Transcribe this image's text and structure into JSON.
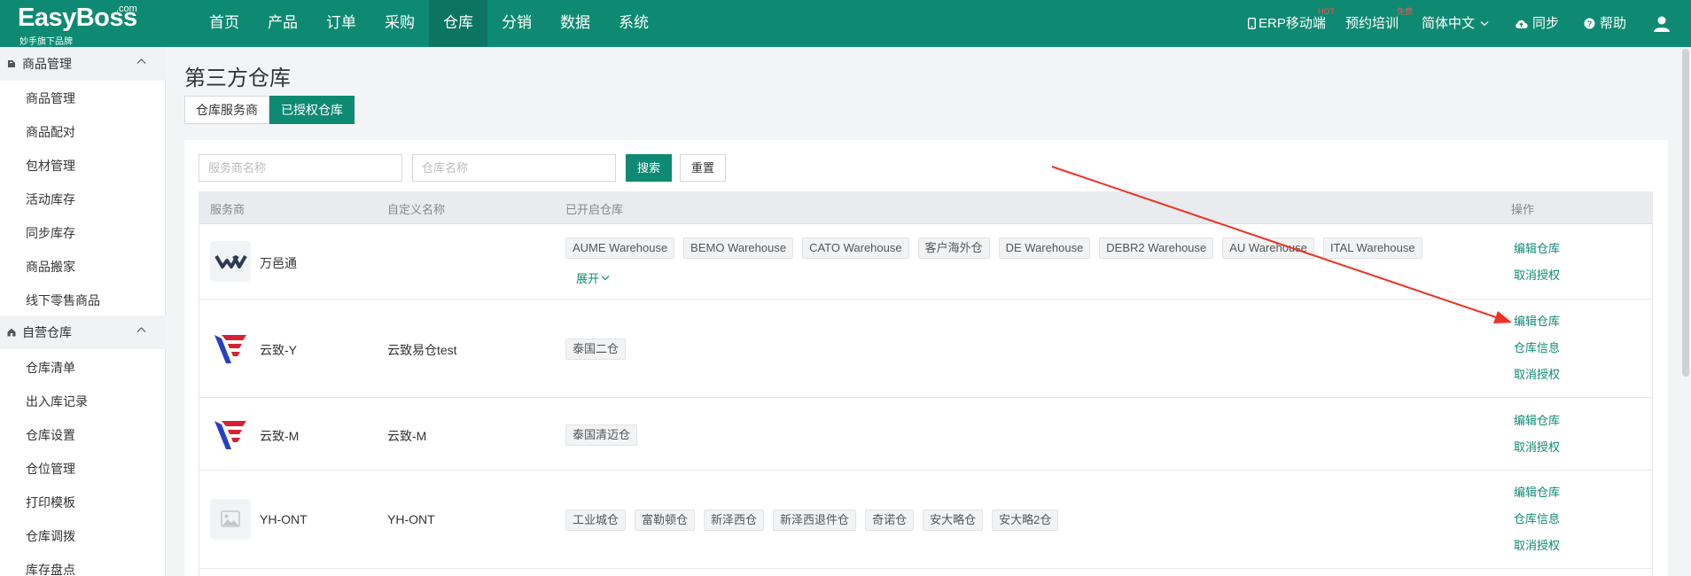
{
  "brand": {
    "name": "EasyBoss",
    "domain": ".com",
    "slogan": "妙手旗下品牌"
  },
  "nav": [
    {
      "label": "首页"
    },
    {
      "label": "产品"
    },
    {
      "label": "订单"
    },
    {
      "label": "采购"
    },
    {
      "label": "仓库",
      "active": true
    },
    {
      "label": "分销"
    },
    {
      "label": "数据"
    },
    {
      "label": "系统"
    }
  ],
  "topright": {
    "erp": "ERP移动端",
    "erp_badge": "HOT",
    "training": "预约培训",
    "training_badge": "免费",
    "lang": "简体中文",
    "sync": "同步",
    "help": "帮助"
  },
  "sidebar": {
    "group1": {
      "label": "商品管理",
      "items": [
        "商品管理",
        "商品配对",
        "包材管理",
        "活动库存",
        "同步库存",
        "商品搬家",
        "线下零售商品"
      ]
    },
    "group2": {
      "label": "自营仓库",
      "items": [
        "仓库清单",
        "出入库记录",
        "仓库设置",
        "仓位管理",
        "打印模板",
        "仓库调拨",
        "库存盘点"
      ]
    }
  },
  "page": {
    "title": "第三方仓库",
    "tabs": [
      {
        "label": "仓库服务商"
      },
      {
        "label": "已授权仓库",
        "active": true
      }
    ]
  },
  "filters": {
    "provider_placeholder": "服务商名称",
    "warehouse_placeholder": "仓库名称",
    "search": "搜索",
    "reset": "重置"
  },
  "table": {
    "headers": {
      "provider": "服务商",
      "custom_name": "自定义名称",
      "warehouses": "已开启仓库",
      "actions": "操作"
    },
    "rows": [
      {
        "provider": "万邑通",
        "custom_name": "",
        "logo": "winit-logo",
        "warehouses": [
          "AUME Warehouse",
          "BEMO Warehouse",
          "CATO Warehouse",
          "客户海外仓",
          "DE Warehouse",
          "DEBR2 Warehouse",
          "AU Warehouse",
          "ITAL Warehouse"
        ],
        "expand": "展开",
        "actions": [
          "编辑仓库",
          "取消授权"
        ]
      },
      {
        "provider": "云致-Y",
        "custom_name": "云致易仓test",
        "logo": "yunzhi-logo",
        "warehouses": [
          "泰国二仓"
        ],
        "actions": [
          "编辑仓库",
          "仓库信息",
          "取消授权"
        ]
      },
      {
        "provider": "云致-M",
        "custom_name": "云致-M",
        "logo": "yunzhi-logo",
        "warehouses": [
          "泰国清迈仓"
        ],
        "actions": [
          "编辑仓库",
          "取消授权"
        ]
      },
      {
        "provider": "YH-ONT",
        "custom_name": "YH-ONT",
        "logo": "image-placeholder-icon",
        "warehouses": [
          "工业城仓",
          "富勒顿仓",
          "新泽西仓",
          "新泽西退件仓",
          "奇诺仓",
          "安大略仓",
          "安大略2仓"
        ],
        "actions": [
          "编辑仓库",
          "仓库信息",
          "取消授权"
        ]
      }
    ]
  },
  "colors": {
    "brand": "#0e8a72",
    "annotation_arrow": "#ee3124"
  }
}
